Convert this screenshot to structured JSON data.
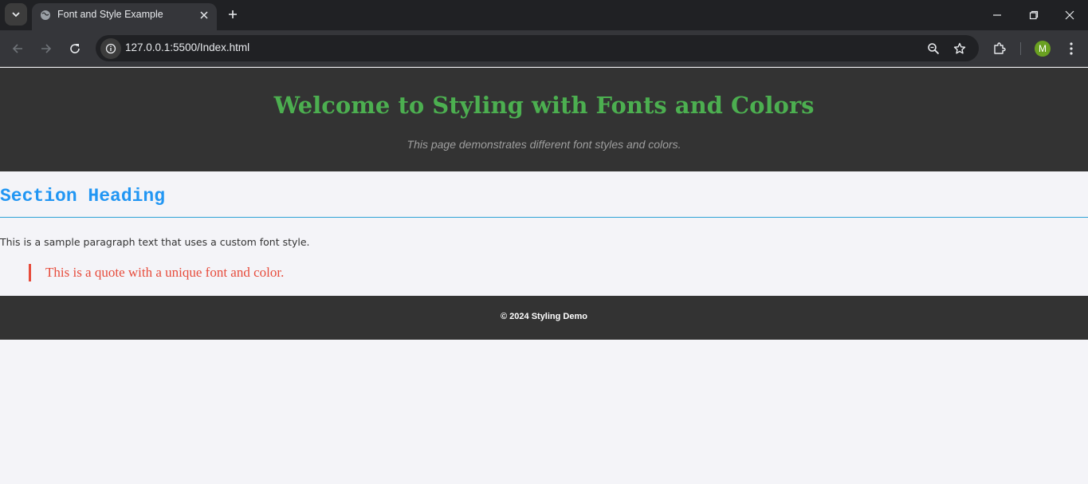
{
  "browser": {
    "tab_title": "Font and Style Example",
    "url": "127.0.0.1:5500/Index.html",
    "profile_initial": "M",
    "icons": [
      "tab-search-icon",
      "globe-icon",
      "close-icon",
      "plus-icon",
      "minimize-icon",
      "restore-icon",
      "window-close-icon",
      "back-arrow-icon",
      "forward-arrow-icon",
      "reload-icon",
      "info-icon",
      "zoom-icon",
      "star-icon",
      "puzzle-icon",
      "more-vert-icon"
    ]
  },
  "page": {
    "title": "Welcome to Styling with Fonts and Colors",
    "subtitle": "This page demonstrates different font styles and colors.",
    "section_heading": "Section Heading",
    "paragraph": "This is a sample paragraph text that uses a custom font style.",
    "quote": "This is a quote with a unique font and color.",
    "footer": "© 2024 Styling Demo"
  },
  "colors": {
    "header_bg": "#333333",
    "title": "#4caf50",
    "subtitle": "#9e9e9e",
    "section_heading": "#2196f3",
    "quote": "#e74c3c",
    "page_bg": "#f4f4f8"
  }
}
